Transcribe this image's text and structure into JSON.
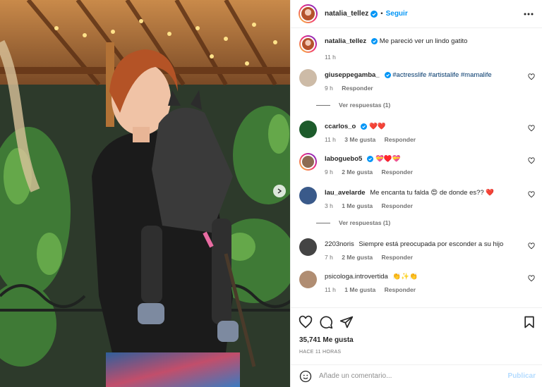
{
  "post": {
    "author": "natalia_tellez",
    "follow_label": "Seguir",
    "dot": "•",
    "caption_text": "Me pareció ver un lindo gatito",
    "caption_time": "11 h"
  },
  "comments": [
    {
      "user": "giuseppegamba_",
      "verified": true,
      "text": "#actresslife #artistalife #mamalife",
      "is_tags": true,
      "time": "9 h",
      "likes": "",
      "reply": "Responder",
      "avatar_color": "#cdbba7",
      "view_replies": "Ver respuestas (1)"
    },
    {
      "user": "ccarlos_o",
      "verified": true,
      "text": "❤️❤️",
      "time": "11 h",
      "likes": "3 Me gusta",
      "reply": "Responder",
      "avatar_color": "#1d5b2b"
    },
    {
      "user": "laboguebo5",
      "verified": true,
      "text": "💝♥️💝",
      "time": "9 h",
      "likes": "2 Me gusta",
      "reply": "Responder",
      "avatar_color": "#8d6b52",
      "ring": true
    },
    {
      "user": "lau_avelarde",
      "verified": false,
      "text": "Me encanta tu falda 😍 de donde es?? ❤️",
      "time": "3 h",
      "likes": "1 Me gusta",
      "reply": "Responder",
      "avatar_color": "#3a5a8a",
      "view_replies": "Ver respuestas (1)"
    },
    {
      "user": "2203noris",
      "verified": false,
      "text": "Siempre está preocupada por esconder a su hijo",
      "time": "7 h",
      "likes": "2 Me gusta",
      "reply": "Responder",
      "avatar_color": "#444"
    },
    {
      "user": "psicologa.introvertida",
      "verified": false,
      "text": "👏✨👏",
      "time": "11 h",
      "likes": "1 Me gusta",
      "reply": "Responder",
      "avatar_color": "#b08d72"
    }
  ],
  "footer": {
    "likes": "35,741 Me gusta",
    "date": "HACE 11 HORAS",
    "comment_placeholder": "Añade un comentario...",
    "publish_label": "Publicar"
  },
  "colors": {
    "accent": "#0095f6",
    "text": "#262626",
    "muted": "#737373"
  }
}
